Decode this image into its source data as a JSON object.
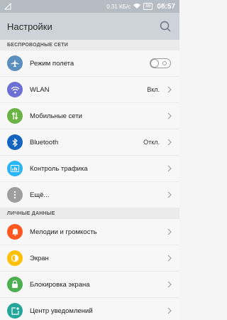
{
  "status": {
    "speed": "0.31 КБ/с",
    "battery": "88",
    "time": "08:57"
  },
  "appbar": {
    "title": "Настройки"
  },
  "sections": [
    {
      "header": "БЕСПРОВОДНЫЕ СЕТИ",
      "items": [
        {
          "label": "Режим полета",
          "color": "#5a8fbf",
          "icon": "airplane-icon",
          "control": "toggle",
          "state": "off"
        },
        {
          "label": "WLAN",
          "value": "Вкл.",
          "color": "#6c6fd3",
          "icon": "wifi-icon"
        },
        {
          "label": "Мобильные сети",
          "color": "#6ab344",
          "icon": "mobile-data-icon"
        },
        {
          "label": "Bluetooth",
          "value": "Откл.",
          "color": "#1565c0",
          "icon": "bluetooth-icon"
        },
        {
          "label": "Контроль трафика",
          "color": "#29b6f6",
          "icon": "traffic-icon"
        },
        {
          "label": "Ещё...",
          "color": "#9e9e9e",
          "icon": "more-icon"
        }
      ]
    },
    {
      "header": "ЛИЧНЫЕ ДАННЫЕ",
      "items": [
        {
          "label": "Мелодии и громкость",
          "color": "#ff5722",
          "icon": "bell-icon"
        },
        {
          "label": "Экран",
          "color": "#ffc107",
          "icon": "brightness-icon"
        },
        {
          "label": "Блокировка экрана",
          "color": "#4caf50",
          "icon": "lock-icon"
        },
        {
          "label": "Центр уведомлений",
          "color": "#26a69a",
          "icon": "notification-icon"
        }
      ]
    }
  ]
}
